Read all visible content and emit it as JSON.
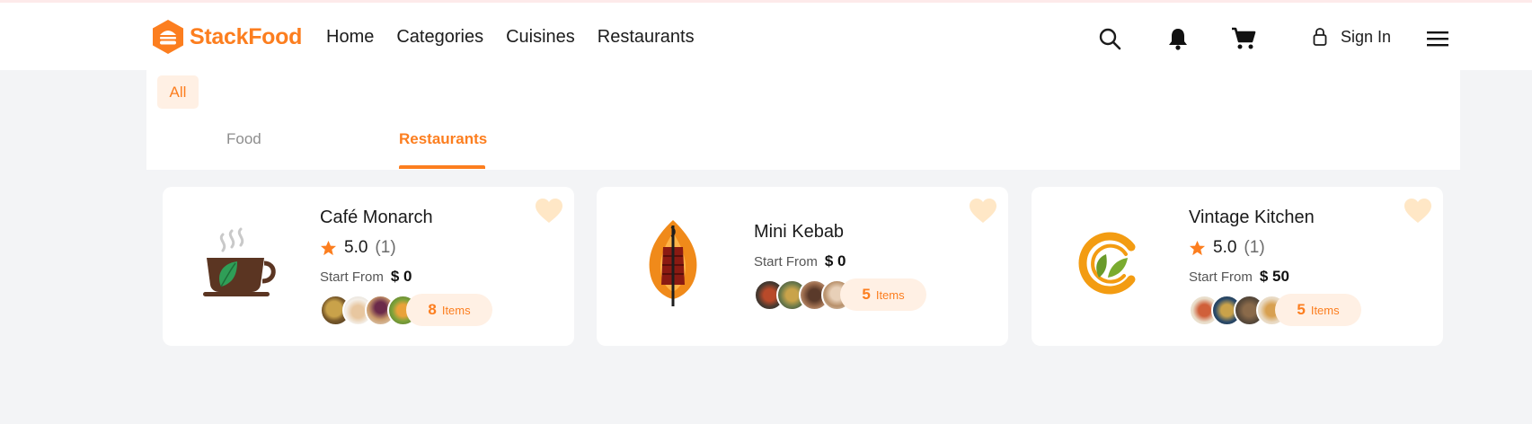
{
  "brand": {
    "name": "StackFood",
    "accent": "#fc7e1f"
  },
  "nav": {
    "links": [
      "Home",
      "Categories",
      "Cuisines",
      "Restaurants"
    ],
    "sign_in": "Sign In",
    "icons": [
      "search-icon",
      "bell-icon",
      "cart-icon",
      "lock-icon",
      "menu-icon"
    ]
  },
  "filters": {
    "chip": "All",
    "tabs": [
      "Food",
      "Restaurants"
    ],
    "active_tab": "Restaurants"
  },
  "restaurants": [
    {
      "name": "Café Monarch",
      "rating": "5.0",
      "reviews": "(1)",
      "start_label": "Start From",
      "start_price": "$ 0",
      "items_count": "8",
      "items_label": "Items"
    },
    {
      "name": "Mini Kebab",
      "start_label": "Start From",
      "start_price": "$ 0",
      "items_count": "5",
      "items_label": "Items"
    },
    {
      "name": "Vintage Kitchen",
      "rating": "5.0",
      "reviews": "(1)",
      "start_label": "Start From",
      "start_price": "$ 50",
      "items_count": "5",
      "items_label": "Items"
    }
  ]
}
